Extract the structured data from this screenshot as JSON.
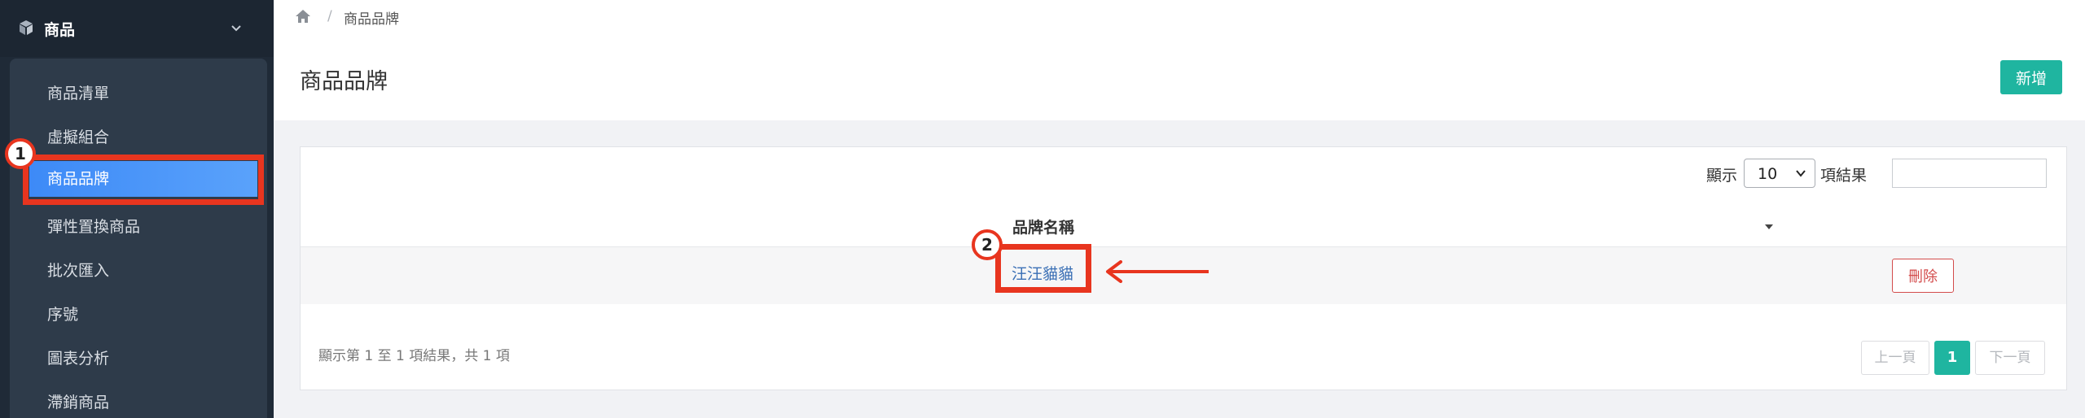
{
  "sidebar": {
    "section_title": "商品",
    "items": [
      {
        "label": "商品清單"
      },
      {
        "label": "虛擬組合"
      },
      {
        "label": "商品品牌"
      },
      {
        "label": "彈性置換商品"
      },
      {
        "label": "批次匯入"
      },
      {
        "label": "序號"
      },
      {
        "label": "圖表分析"
      },
      {
        "label": "滯銷商品"
      }
    ],
    "active_index": 2
  },
  "annotations": {
    "badge_1": "1",
    "badge_2": "2",
    "highlight_color": "#e8351f"
  },
  "breadcrumb": {
    "separator": "/",
    "current": "商品品牌"
  },
  "header": {
    "title": "商品品牌",
    "add_button": "新增"
  },
  "table_controls": {
    "show_label": "顯示",
    "page_length": "10",
    "result_label": "項結果",
    "search_value": ""
  },
  "table": {
    "columns": [
      "品牌名稱"
    ],
    "rows": [
      {
        "name": "汪汪貓貓",
        "delete_label": "刪除"
      }
    ]
  },
  "footer": {
    "info": "顯示第 1 至 1 項結果，共 1 項",
    "prev": "上一頁",
    "current_page": "1",
    "next": "下一頁"
  },
  "colors": {
    "accent": "#1fb5a0",
    "sidebar_bg": "#1f2a37",
    "active_item": "#4a93f8",
    "danger": "#d34c4c",
    "link": "#3a6fb5"
  }
}
